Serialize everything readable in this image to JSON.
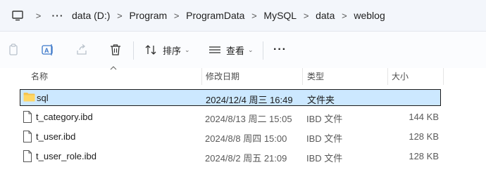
{
  "breadcrumb": {
    "items": [
      "data (D:)",
      "Program",
      "ProgramData",
      "MySQL",
      "data",
      "weblog"
    ]
  },
  "toolbar": {
    "sort_label": "排序",
    "view_label": "查看"
  },
  "columns": {
    "name": "名称",
    "date": "修改日期",
    "type": "类型",
    "size": "大小"
  },
  "files": [
    {
      "name": "sql",
      "date": "2024/12/4 周三 16:49",
      "type": "文件夹",
      "size": "",
      "icon": "folder-icon",
      "selected": true
    },
    {
      "name": "t_category.ibd",
      "date": "2024/8/13 周二 15:05",
      "type": "IBD 文件",
      "size": "144 KB",
      "icon": "file-icon",
      "selected": false
    },
    {
      "name": "t_user.ibd",
      "date": "2024/8/8 周四 15:00",
      "type": "IBD 文件",
      "size": "128 KB",
      "icon": "file-icon",
      "selected": false
    },
    {
      "name": "t_user_role.ibd",
      "date": "2024/8/2 周五 21:09",
      "type": "IBD 文件",
      "size": "128 KB",
      "icon": "file-icon",
      "selected": false
    }
  ],
  "colors": {
    "selection_bg": "#cce8ff",
    "folder": "#f5c451"
  }
}
